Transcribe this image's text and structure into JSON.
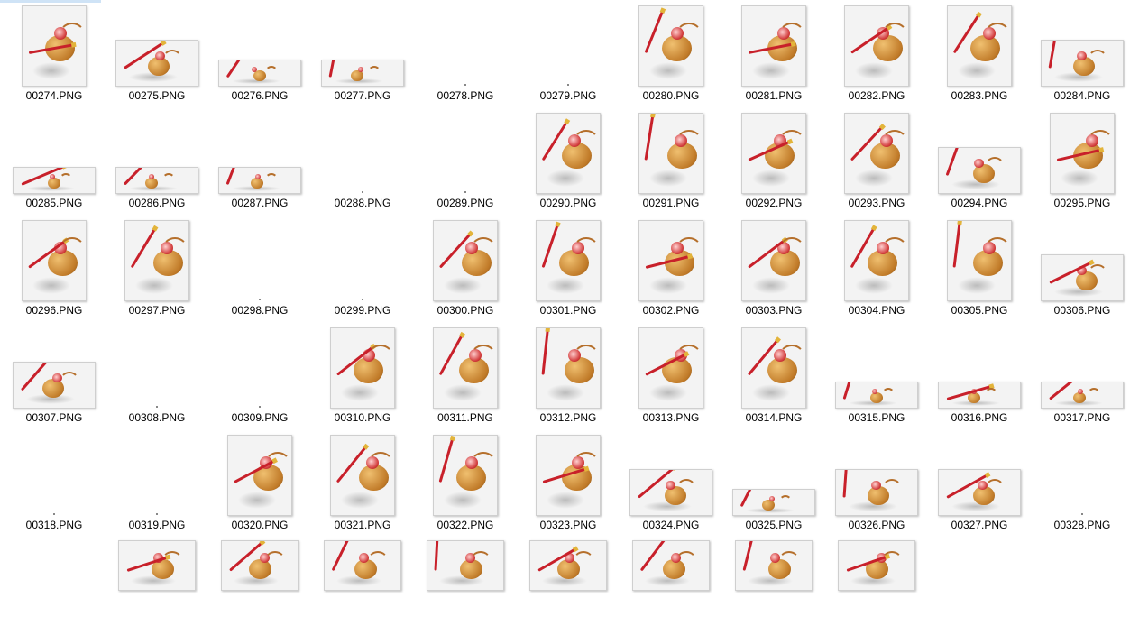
{
  "window": {
    "title": ""
  },
  "files": [
    {
      "name": "00274.PNG",
      "v": 1,
      "orient": "tall"
    },
    {
      "name": "00275.PNG",
      "v": 1,
      "orient": "wide"
    },
    {
      "name": "00276.PNG",
      "v": 1,
      "orient": "flat"
    },
    {
      "name": "00277.PNG",
      "v": 1,
      "orient": "flat"
    },
    {
      "name": "00278.PNG",
      "v": 0,
      "orient": "none"
    },
    {
      "name": "00279.PNG",
      "v": 0,
      "orient": "none"
    },
    {
      "name": "00280.PNG",
      "v": 1,
      "orient": "tall"
    },
    {
      "name": "00281.PNG",
      "v": 1,
      "orient": "tall"
    },
    {
      "name": "00282.PNG",
      "v": 1,
      "orient": "tall"
    },
    {
      "name": "00283.PNG",
      "v": 1,
      "orient": "tall"
    },
    {
      "name": "00284.PNG",
      "v": 1,
      "orient": "wide"
    },
    {
      "name": "00285.PNG",
      "v": 1,
      "orient": "flat"
    },
    {
      "name": "00286.PNG",
      "v": 1,
      "orient": "flat"
    },
    {
      "name": "00287.PNG",
      "v": 1,
      "orient": "flat"
    },
    {
      "name": "00288.PNG",
      "v": 0,
      "orient": "none"
    },
    {
      "name": "00289.PNG",
      "v": 0,
      "orient": "none"
    },
    {
      "name": "00290.PNG",
      "v": 1,
      "orient": "tall"
    },
    {
      "name": "00291.PNG",
      "v": 1,
      "orient": "tall"
    },
    {
      "name": "00292.PNG",
      "v": 1,
      "orient": "tall"
    },
    {
      "name": "00293.PNG",
      "v": 1,
      "orient": "tall"
    },
    {
      "name": "00294.PNG",
      "v": 1,
      "orient": "wide"
    },
    {
      "name": "00295.PNG",
      "v": 1,
      "orient": "tall"
    },
    {
      "name": "00296.PNG",
      "v": 1,
      "orient": "tall"
    },
    {
      "name": "00297.PNG",
      "v": 1,
      "orient": "tall"
    },
    {
      "name": "00298.PNG",
      "v": 0,
      "orient": "none"
    },
    {
      "name": "00299.PNG",
      "v": 0,
      "orient": "none"
    },
    {
      "name": "00300.PNG",
      "v": 1,
      "orient": "tall"
    },
    {
      "name": "00301.PNG",
      "v": 1,
      "orient": "tall"
    },
    {
      "name": "00302.PNG",
      "v": 1,
      "orient": "tall"
    },
    {
      "name": "00303.PNG",
      "v": 1,
      "orient": "tall"
    },
    {
      "name": "00304.PNG",
      "v": 1,
      "orient": "tall"
    },
    {
      "name": "00305.PNG",
      "v": 1,
      "orient": "tall"
    },
    {
      "name": "00306.PNG",
      "v": 1,
      "orient": "wide"
    },
    {
      "name": "00307.PNG",
      "v": 1,
      "orient": "wide"
    },
    {
      "name": "00308.PNG",
      "v": 0,
      "orient": "none"
    },
    {
      "name": "00309.PNG",
      "v": 0,
      "orient": "none"
    },
    {
      "name": "00310.PNG",
      "v": 1,
      "orient": "tall"
    },
    {
      "name": "00311.PNG",
      "v": 1,
      "orient": "tall"
    },
    {
      "name": "00312.PNG",
      "v": 1,
      "orient": "tall"
    },
    {
      "name": "00313.PNG",
      "v": 1,
      "orient": "tall"
    },
    {
      "name": "00314.PNG",
      "v": 1,
      "orient": "tall"
    },
    {
      "name": "00315.PNG",
      "v": 1,
      "orient": "flat"
    },
    {
      "name": "00316.PNG",
      "v": 1,
      "orient": "flat"
    },
    {
      "name": "00317.PNG",
      "v": 1,
      "orient": "flat"
    },
    {
      "name": "00318.PNG",
      "v": 0,
      "orient": "none"
    },
    {
      "name": "00319.PNG",
      "v": 0,
      "orient": "none"
    },
    {
      "name": "00320.PNG",
      "v": 1,
      "orient": "tall"
    },
    {
      "name": "00321.PNG",
      "v": 1,
      "orient": "tall"
    },
    {
      "name": "00322.PNG",
      "v": 1,
      "orient": "tall"
    },
    {
      "name": "00323.PNG",
      "v": 1,
      "orient": "tall"
    },
    {
      "name": "00324.PNG",
      "v": 1,
      "orient": "wide"
    },
    {
      "name": "00325.PNG",
      "v": 1,
      "orient": "flat"
    },
    {
      "name": "00326.PNG",
      "v": 1,
      "orient": "wide"
    },
    {
      "name": "00327.PNG",
      "v": 1,
      "orient": "wide"
    },
    {
      "name": "00328.PNG",
      "v": 0,
      "orient": "none"
    },
    {
      "name": "",
      "v": 0,
      "orient": "gap"
    },
    {
      "name": "",
      "v": 1,
      "orient": "partial"
    },
    {
      "name": "",
      "v": 1,
      "orient": "partial"
    },
    {
      "name": "",
      "v": 1,
      "orient": "partial"
    },
    {
      "name": "",
      "v": 1,
      "orient": "partial"
    },
    {
      "name": "",
      "v": 1,
      "orient": "partial"
    },
    {
      "name": "",
      "v": 1,
      "orient": "partial"
    },
    {
      "name": "",
      "v": 1,
      "orient": "partial"
    },
    {
      "name": "",
      "v": 1,
      "orient": "partial"
    }
  ]
}
